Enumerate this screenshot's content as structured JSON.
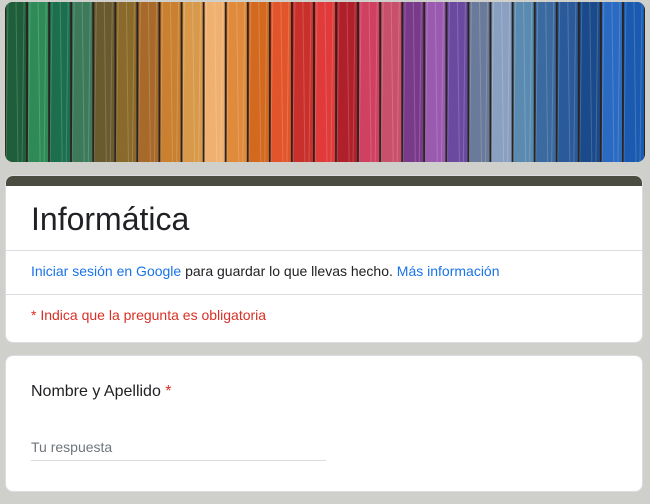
{
  "banner": {
    "colors": [
      "#1f5e3a",
      "#2e8b57",
      "#1b6f4f",
      "#3c7a5a",
      "#6b5a2e",
      "#8a6a2a",
      "#a86a2a",
      "#c9802f",
      "#d89a4a",
      "#f0b070",
      "#e08a3c",
      "#d2691e",
      "#e2552a",
      "#c9302c",
      "#e03a3a",
      "#b0202a",
      "#d04060",
      "#c8506a",
      "#7a3a8a",
      "#9a5ab0",
      "#6a4aa0",
      "#6a7a9a",
      "#8aa0c0",
      "#5a8ab0",
      "#3a6aa0",
      "#2a5a9a",
      "#1a4a8a",
      "#2a6ac0",
      "#1a5ab0"
    ]
  },
  "header": {
    "title": "Informática",
    "accent_color": "#4a4c41"
  },
  "signin": {
    "link_label": "Iniciar sesión en Google",
    "middle_text": " para guardar lo que llevas hecho. ",
    "more_label": "Más información"
  },
  "required_note": "* Indica que la pregunta es obligatoria",
  "question": {
    "label": "Nombre y Apellido",
    "required_mark": "*",
    "placeholder": "Tu respuesta"
  }
}
